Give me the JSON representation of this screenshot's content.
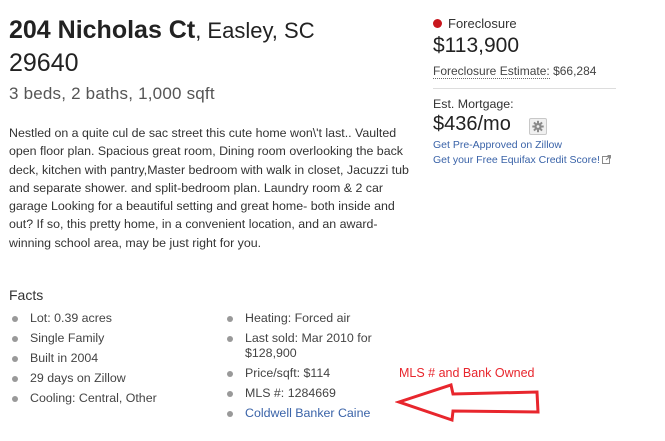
{
  "listing": {
    "street": "204 Nicholas Ct",
    "city": ", Easley, SC",
    "zip": "29640",
    "specs": "3 beds, 2 baths, 1,000 sqft",
    "description": "Nestled on a quite cul de sac street this cute home won\\'t last.. Vaulted open floor plan. Spacious great room, Dining room overlooking the back deck, kitchen with pantry,Master bedroom with walk in closet, Jacuzzi tub and separate shower. and split-bedroom plan. Laundry room & 2 car garage Looking for a beautiful setting and great home- both inside and out? If so, this pretty home, in a convenient location, and an award-winning school area, may be just right for you."
  },
  "facts": {
    "title": "Facts",
    "left": [
      "Lot: 0.39 acres",
      "Single Family",
      "Built in 2004",
      "29 days on Zillow",
      "Cooling: Central, Other"
    ],
    "right": [
      "Heating: Forced air",
      "Last sold: Mar 2010 for $128,900",
      "Price/sqft: $114",
      "MLS #: 1284669"
    ],
    "agent_link": "Coldwell Banker Caine"
  },
  "sidebar": {
    "status": "Foreclosure",
    "status_color": "#c8161d",
    "price": "$113,900",
    "estimate_label": "Foreclosure Estimate:",
    "estimate_value": "$66,284",
    "mortgage_label": "Est. Mortgage:",
    "mortgage_value": "$436/mo",
    "mortgage_settings_icon": "gear-icon",
    "preapproved_link": "Get Pre-Approved on Zillow",
    "credit_link": "Get your Free Equifax Credit Score!"
  },
  "annotation": {
    "text": "MLS # and Bank Owned",
    "color": "#e8262d"
  }
}
